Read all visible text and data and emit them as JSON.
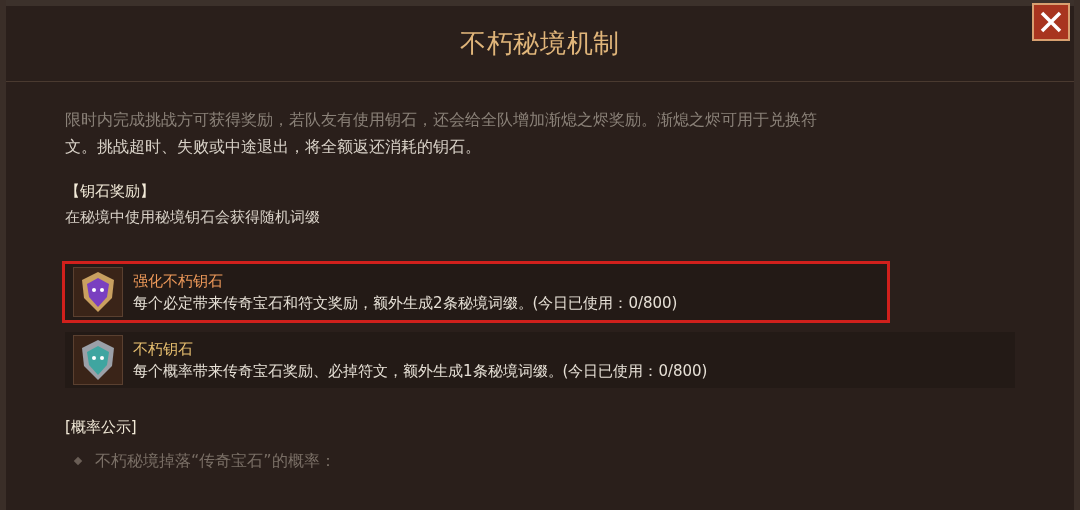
{
  "window": {
    "title": "不朽秘境机制"
  },
  "intro": [
    "限时内完成挑战方可获得奖励，若队友有使用钥石，还会给全队增加渐熄之烬奖励。渐熄之烬可用于兑换符",
    "文。挑战超时、失败或中途退出，将全额返还消耗的钥石。"
  ],
  "reward_section": {
    "heading": "【钥石奖励】",
    "description": "在秘境中使用秘境钥石会获得随机词缀"
  },
  "keystones": [
    {
      "kind": "empowered",
      "name": "强化不朽钥石",
      "description": "每个必定带来传奇宝石和符文奖励，额外生成2条秘境词缀。(今日已使用：0/800)",
      "highlighted": true
    },
    {
      "kind": "normal",
      "name": "不朽钥石",
      "description": "每个概率带来传奇宝石奖励、必掉符文，额外生成1条秘境词缀。(今日已使用：0/800)",
      "highlighted": false
    }
  ],
  "probability_section": {
    "heading": "[概率公示]",
    "items": [
      "不朽秘境掉落“传奇宝石”的概率："
    ]
  }
}
